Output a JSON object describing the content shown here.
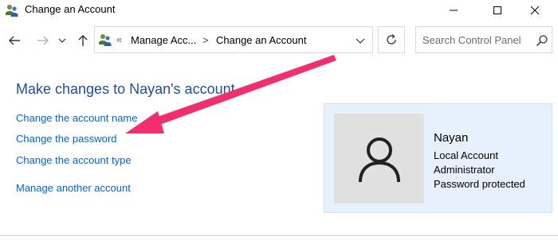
{
  "window": {
    "title": "Change an Account",
    "icon": "user-accounts-icon",
    "controls": [
      "minimize-icon",
      "maximize-icon",
      "close-icon"
    ]
  },
  "navigation": {
    "back_icon": "arrow-left-icon",
    "forward_icon": "arrow-right-icon",
    "recent_icon": "chevron-down-icon",
    "up_icon": "arrow-up-icon"
  },
  "address_bar": {
    "overflow": "«",
    "crumbs": [
      "Manage Acc...",
      "Change an Account"
    ],
    "separator": ">",
    "dropdown_icon": "chevron-down-icon"
  },
  "refresh_icon": "refresh-icon",
  "search": {
    "placeholder": "Search Control Panel",
    "icon": "search-icon"
  },
  "main": {
    "heading": "Make changes to Nayan's account",
    "links": [
      "Change the account name",
      "Change the password",
      "Change the account type",
      "Manage another account"
    ]
  },
  "account": {
    "name": "Nayan",
    "details": [
      "Local Account",
      "Administrator",
      "Password protected"
    ],
    "avatar_icon": "user-avatar-icon"
  },
  "annotation": {
    "color": "#f0306e",
    "points_to": "Change the password"
  },
  "colors": {
    "heading": "#1e4f9c",
    "link": "#0066cc",
    "card_bg": "#e6f1fb"
  }
}
